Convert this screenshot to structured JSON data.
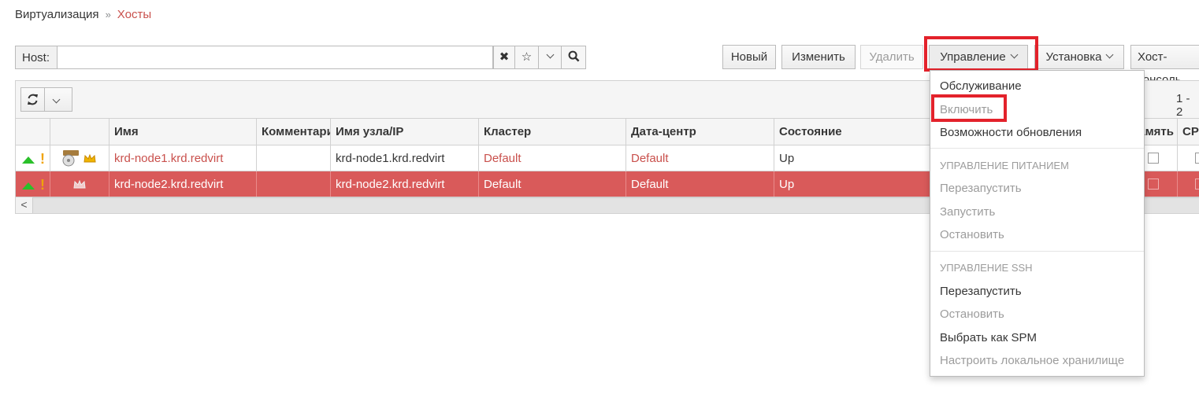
{
  "breadcrumb": {
    "root": "Виртуализация",
    "sep": "»",
    "current": "Хосты"
  },
  "search": {
    "label": "Host:",
    "value": "",
    "placeholder": ""
  },
  "toolbar": {
    "new": "Новый",
    "edit": "Изменить",
    "remove": "Удалить",
    "manage": "Управление",
    "install": "Установка",
    "console": "Хост-консоль"
  },
  "pager": "1 - 2",
  "columns": [
    "Имя",
    "Комментарий",
    "Имя узла/IP",
    "Кластер",
    "Дата-центр",
    "Состояние",
    "Память",
    "CPU"
  ],
  "rows": [
    {
      "name": "krd-node1.krd.redvirt",
      "comment": "",
      "host": "krd-node1.krd.redvirt",
      "cluster": "Default",
      "datacenter": "Default",
      "status": "Up",
      "selected": false
    },
    {
      "name": "krd-node2.krd.redvirt",
      "comment": "",
      "host": "krd-node2.krd.redvirt",
      "cluster": "Default",
      "datacenter": "Default",
      "status": "Up",
      "selected": true
    }
  ],
  "menu": {
    "maintenance": "Обслуживание",
    "activate": "Включить",
    "check_upgrade": "Возможности обновления",
    "power_header": "УПРАВЛЕНИЕ ПИТАНИЕМ",
    "power_restart": "Перезапустить",
    "power_start": "Запустить",
    "power_stop": "Остановить",
    "ssh_header": "УПРАВЛЕНИЕ SSH",
    "ssh_restart": "Перезапустить",
    "ssh_stop": "Остановить",
    "select_spm": "Выбрать как SPM",
    "local_storage": "Настроить локальное хранилище"
  },
  "colors": {
    "accent": "#c9504c",
    "selected_row": "#d95a5a",
    "highlight_box": "#e3222b",
    "status_up": "#2ac02a",
    "warning": "#f0a30a"
  }
}
